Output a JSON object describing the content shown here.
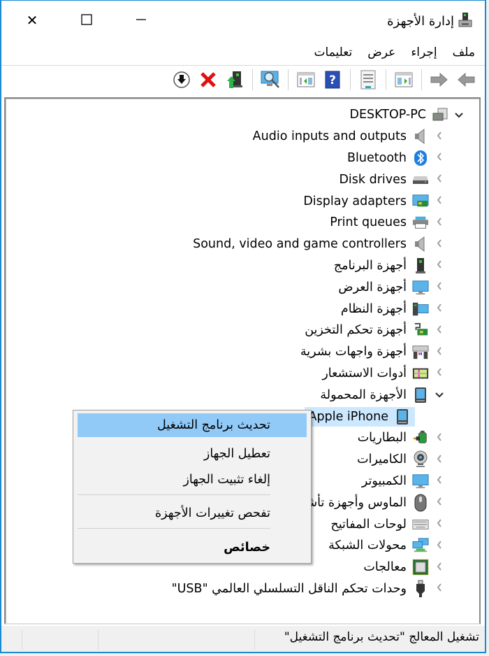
{
  "window": {
    "title": "إدارة الأجهزة",
    "controls": {
      "close": "✕",
      "maximize": "☐",
      "minimize": "—"
    }
  },
  "menubar": {
    "items": [
      "ملف",
      "إجراء",
      "عرض",
      "تعليمات"
    ]
  },
  "toolbar": {
    "buttons": [
      "back-arrow",
      "forward-arrow",
      "show-hide-console-tree",
      "properties",
      "help",
      "show-action-pane",
      "scan-for-hardware-changes",
      "update-driver",
      "uninstall-device",
      "disable-device"
    ]
  },
  "tree": {
    "root": {
      "label": "DESKTOP-PC",
      "icon": "computer-icon",
      "expanded": true
    },
    "items": [
      {
        "label": "Audio inputs and outputs",
        "icon": "speaker-icon",
        "expanded": false
      },
      {
        "label": "Bluetooth",
        "icon": "bluetooth-icon",
        "expanded": false
      },
      {
        "label": "Disk drives",
        "icon": "disk-drive-icon",
        "expanded": false
      },
      {
        "label": "Display adapters",
        "icon": "display-adapter-icon",
        "expanded": false
      },
      {
        "label": "Print queues",
        "icon": "printer-icon",
        "expanded": false
      },
      {
        "label": "Sound, video and game controllers",
        "icon": "speaker-icon",
        "expanded": false
      },
      {
        "label": "أجهزة البرنامج",
        "icon": "software-device-icon",
        "expanded": false
      },
      {
        "label": "أجهزة العرض",
        "icon": "monitor-icon",
        "expanded": false
      },
      {
        "label": "أجهزة النظام",
        "icon": "system-device-icon",
        "expanded": false
      },
      {
        "label": "أجهزة تحكم التخزين",
        "icon": "storage-controller-icon",
        "expanded": false
      },
      {
        "label": "أجهزة واجهات بشرية",
        "icon": "hid-icon",
        "expanded": false
      },
      {
        "label": "أدوات الاستشعار",
        "icon": "sensor-icon",
        "expanded": false
      },
      {
        "label": "الأجهزة المحمولة",
        "icon": "portable-device-icon",
        "expanded": true,
        "children": [
          {
            "label": "Apple iPhone",
            "icon": "portable-device-icon",
            "selected": true
          }
        ]
      },
      {
        "label": "البطاريات",
        "icon": "battery-icon",
        "expanded": false
      },
      {
        "label": "الكاميرات",
        "icon": "camera-icon",
        "expanded": false
      },
      {
        "label": "الكمبيوتر",
        "icon": "monitor-icon",
        "expanded": false
      },
      {
        "label": "الماوس وأجهزة تأشير أخرى",
        "icon": "mouse-icon",
        "expanded": false
      },
      {
        "label": "لوحات المفاتيح",
        "icon": "keyboard-icon",
        "expanded": false
      },
      {
        "label": "محولات الشبكة",
        "icon": "network-adapter-icon",
        "expanded": false
      },
      {
        "label": "معالجات",
        "icon": "processor-icon",
        "expanded": false
      },
      {
        "label": "وحدات تحكم الناقل التسلسلي العالمي \"USB\"",
        "icon": "usb-icon",
        "expanded": false
      }
    ]
  },
  "context_menu": {
    "items": [
      {
        "label": "تحديث برنامج التشغيل",
        "highlighted": true
      },
      {
        "label": "تعطيل الجهاز"
      },
      {
        "label": "إلغاء تثبيت الجهاز"
      },
      {
        "label": "تفحص تغييرات الأجهزة"
      },
      {
        "label": "خصائص",
        "bold": true
      }
    ]
  },
  "statusbar": {
    "text": "تشغيل المعالج \"تحديث برنامج التشغيل\""
  },
  "colors": {
    "window_border": "#1a8ad4",
    "selection": "#cce8ff",
    "menu_highlight": "#91c9f7",
    "menu_bg": "#f2f2f2"
  }
}
